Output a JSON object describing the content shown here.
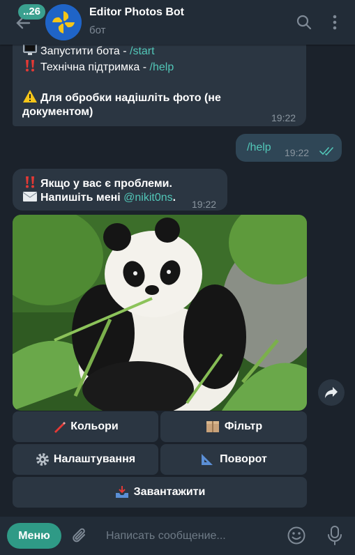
{
  "header": {
    "unread_badge": "..26",
    "title": "Editor Photos Bot",
    "subtitle": "бот"
  },
  "messages": {
    "bot_intro": {
      "start_text": "Запустити бота - ",
      "start_cmd": "/start",
      "help_text": "Технічна підтримка - ",
      "help_cmd": "/help",
      "photo_note_line1": "Для обробки надішліть фото (не",
      "photo_note_line2": "документом)",
      "time": "19:22"
    },
    "user_help": {
      "text": "/help",
      "time": "19:22"
    },
    "bot_problems": {
      "line1": "Якщо у вас є проблеми.",
      "line2_text": "Напишіть мені ",
      "line2_mention": "@nikit0ns",
      "line2_end": ".",
      "time": "19:22"
    }
  },
  "keyboard": {
    "colors": "Кольори",
    "filter": "Фільтр",
    "settings": "Налаштування",
    "rotate": "Поворот",
    "download": "Завантажити"
  },
  "bottom_bar": {
    "menu_label": "Меню",
    "input_placeholder": "Написать сообщение..."
  },
  "colors": {
    "accent": "#2f9a86",
    "link": "#52c7b8",
    "bubble": "#2b3642",
    "outgoing_bubble": "#2f4656",
    "background": "#1b222b"
  }
}
